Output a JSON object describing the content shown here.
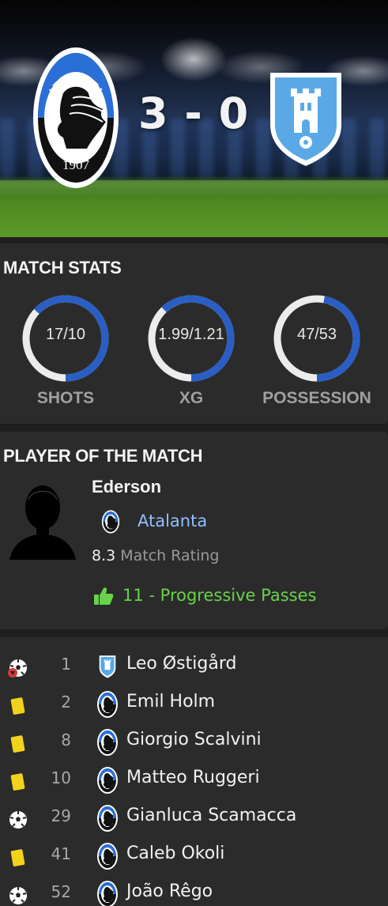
{
  "match": {
    "home_team": "Atalanta",
    "home_logo_text": "ATALANTA",
    "home_logo_year": "1907",
    "score": "3 - 0",
    "home_color": "#2a5ec4",
    "away_color": "#5aa9e6"
  },
  "match_stats": {
    "title": "MATCH STATS",
    "items": [
      {
        "value": "17/10",
        "label": "SHOTS",
        "home_share": 0.63
      },
      {
        "value": "1.99/1.21",
        "label": "XG",
        "home_share": 0.62
      },
      {
        "value": "47/53",
        "label": "POSSESSION",
        "home_share": 0.47
      }
    ]
  },
  "potm": {
    "title": "PLAYER OF THE MATCH",
    "name": "Ederson",
    "team": "Atalanta",
    "rating": "8.3",
    "rating_label": "Match Rating",
    "stat": "11 - Progressive Passes"
  },
  "events": [
    {
      "icon": "own-goal-icon",
      "number": "1",
      "team": "away",
      "player": "Leo Østigård"
    },
    {
      "icon": "yellow-card-icon",
      "number": "2",
      "team": "home",
      "player": "Emil Holm"
    },
    {
      "icon": "yellow-card-icon",
      "number": "8",
      "team": "home",
      "player": "Giorgio Scalvini"
    },
    {
      "icon": "yellow-card-icon",
      "number": "10",
      "team": "home",
      "player": "Matteo Ruggeri"
    },
    {
      "icon": "goal-icon",
      "number": "29",
      "team": "home",
      "player": "Gianluca Scamacca"
    },
    {
      "icon": "yellow-card-icon",
      "number": "41",
      "team": "home",
      "player": "Caleb Okoli"
    },
    {
      "icon": "goal-icon",
      "number": "52",
      "team": "home",
      "player": "João Rêgo"
    }
  ]
}
